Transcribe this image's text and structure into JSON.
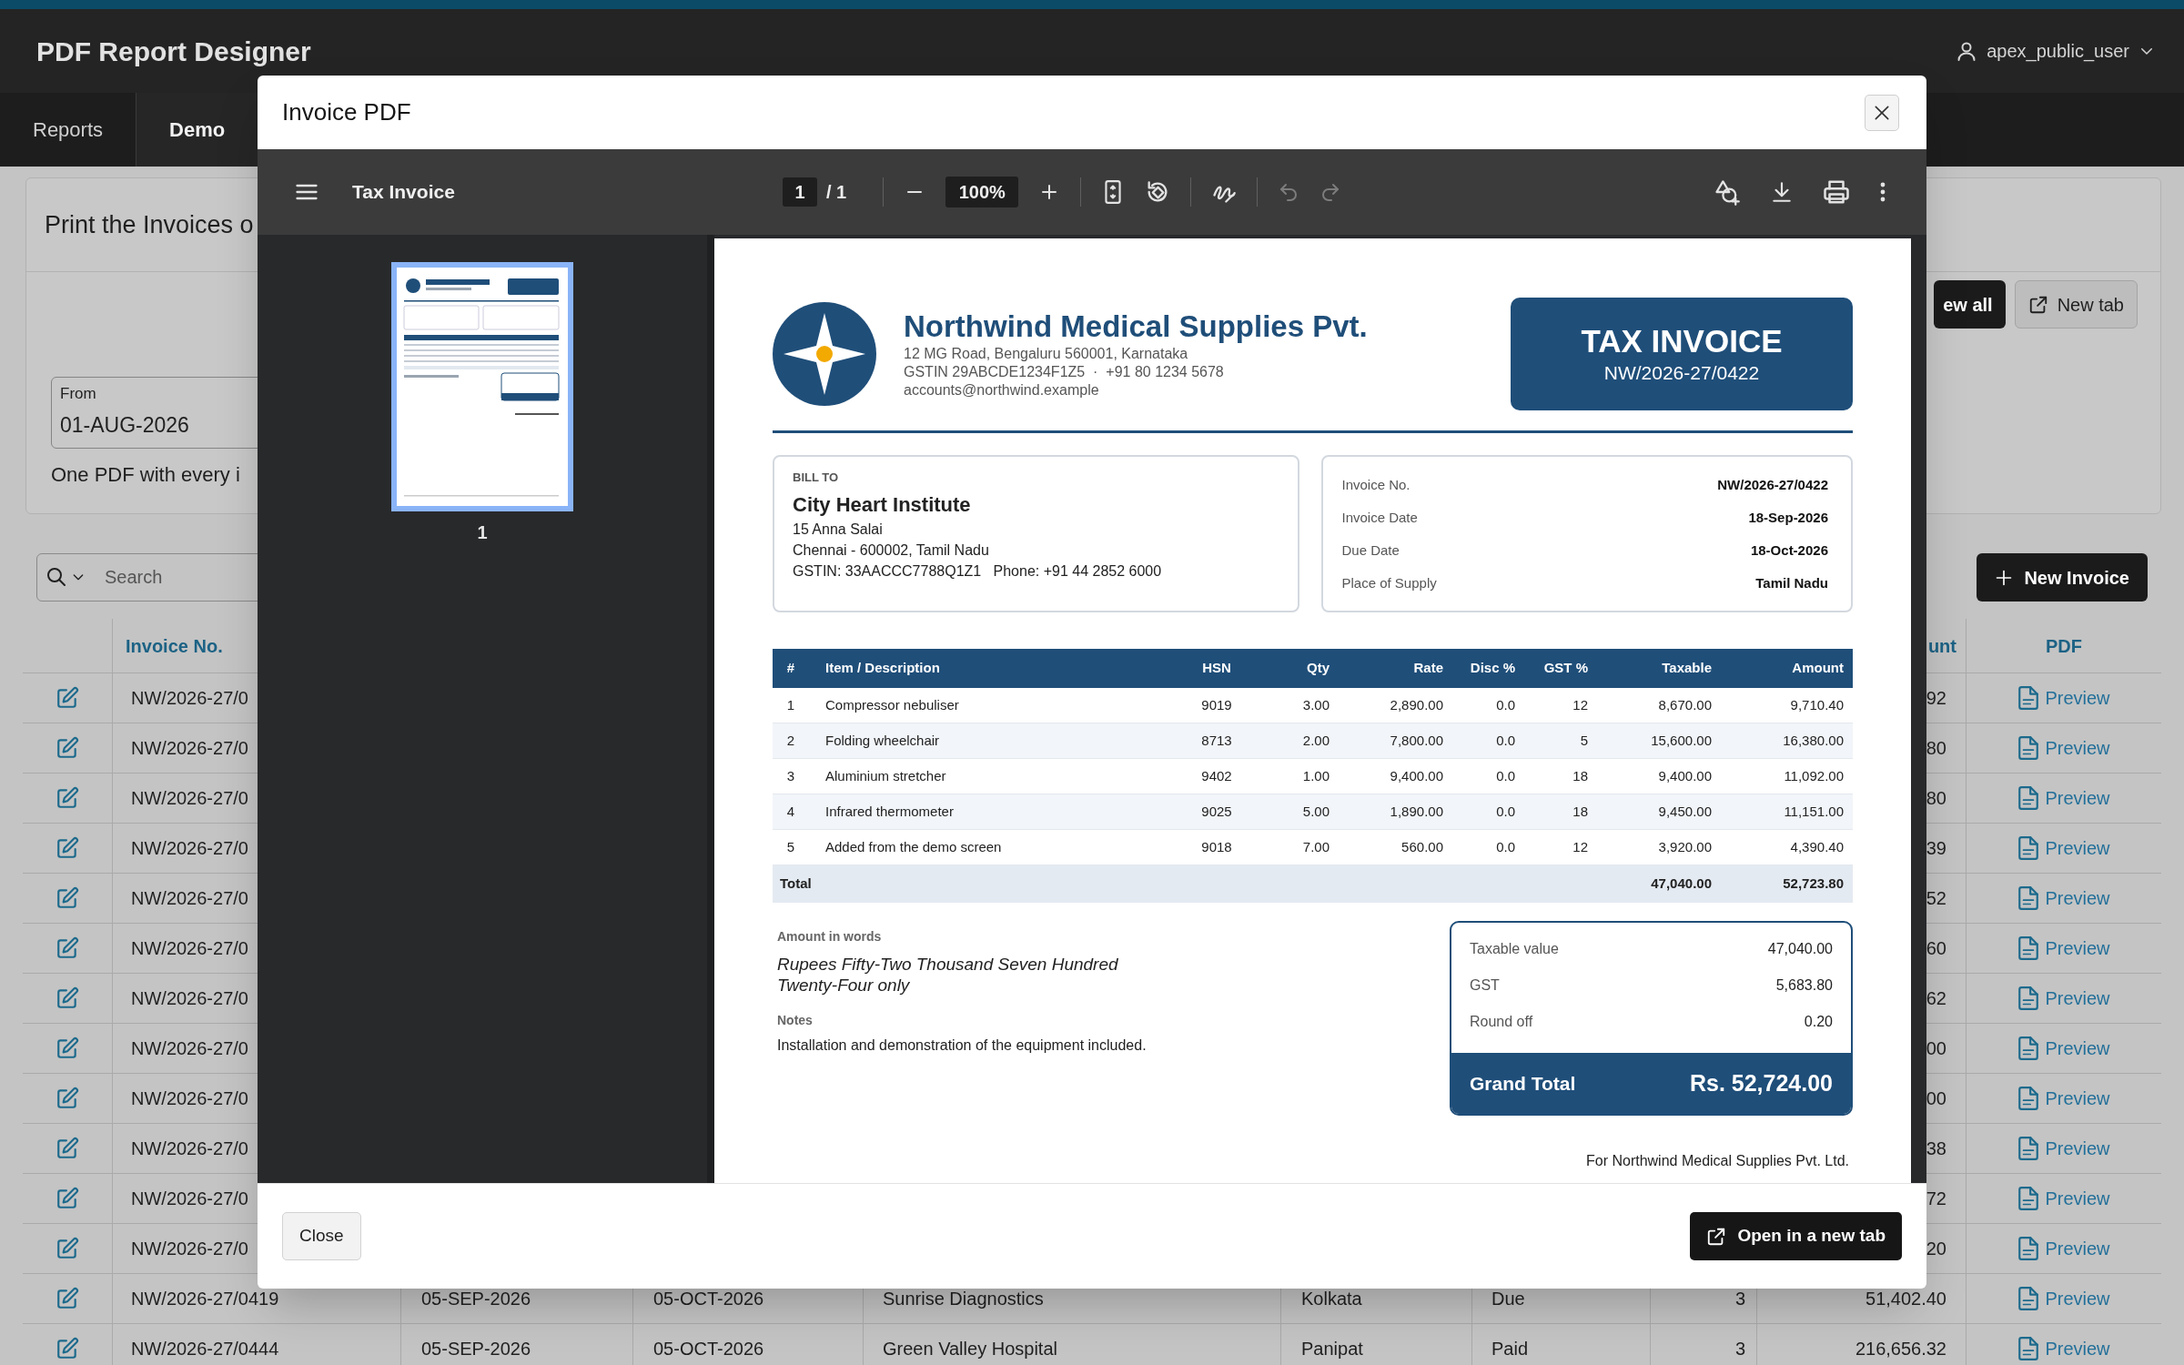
{
  "app": {
    "title": "PDF Report Designer",
    "user": "apex_public_user"
  },
  "nav_tabs": [
    {
      "label": "Reports",
      "selected": false
    },
    {
      "label": "Demo",
      "selected": true
    }
  ],
  "print_card": {
    "title": "Print the Invoices o",
    "from_field": {
      "label": "From",
      "value": "01-AUG-2026"
    },
    "help_text": "One PDF with every i",
    "buttons": [
      {
        "label": "ew all",
        "kind": "primary"
      },
      {
        "label": "New tab",
        "kind": "secondary"
      }
    ]
  },
  "search": {
    "placeholder": "Search"
  },
  "new_button": "New Invoice",
  "table": {
    "columns": {
      "invoice_no": "Invoice No.",
      "amount": "unt",
      "pdf": "PDF"
    },
    "rows": [
      {
        "invoice_no": "NW/2026-27/0",
        "amount": "92",
        "pdf": "Preview"
      },
      {
        "invoice_no": "NW/2026-27/0",
        "amount": "80",
        "pdf": "Preview"
      },
      {
        "invoice_no": "NW/2026-27/0",
        "amount": "80",
        "pdf": "Preview"
      },
      {
        "invoice_no": "NW/2026-27/0",
        "amount": "39",
        "pdf": "Preview"
      },
      {
        "invoice_no": "NW/2026-27/0",
        "amount": "52",
        "pdf": "Preview"
      },
      {
        "invoice_no": "NW/2026-27/0",
        "amount": "60",
        "pdf": "Preview"
      },
      {
        "invoice_no": "NW/2026-27/0",
        "amount": "62",
        "pdf": "Preview"
      },
      {
        "invoice_no": "NW/2026-27/0",
        "amount": "00",
        "pdf": "Preview"
      },
      {
        "invoice_no": "NW/2026-27/0",
        "amount": "00",
        "pdf": "Preview"
      },
      {
        "invoice_no": "NW/2026-27/0",
        "amount": "38",
        "pdf": "Preview"
      },
      {
        "invoice_no": "NW/2026-27/0",
        "amount": "72",
        "pdf": "Preview"
      },
      {
        "invoice_no": "NW/2026-27/0",
        "amount": "20",
        "pdf": "Preview"
      },
      {
        "invoice_no": "NW/2026-27/0419",
        "issue_date": "05-SEP-2026",
        "due_date": "05-OCT-2026",
        "customer": "Sunrise Diagnostics",
        "city": "Kolkata",
        "status": "Due",
        "count": "3",
        "amount": "51,402.40",
        "pdf": "Preview"
      },
      {
        "invoice_no": "NW/2026-27/0444",
        "issue_date": "05-SEP-2026",
        "due_date": "05-OCT-2026",
        "customer": "Green Valley Hospital",
        "city": "Panipat",
        "status": "Paid",
        "count": "3",
        "amount": "216,656.32",
        "pdf": "Preview"
      }
    ]
  },
  "modal": {
    "title": "Invoice PDF",
    "viewer": {
      "document_title": "Tax Invoice",
      "page": "1",
      "page_total": "/ 1",
      "zoom": "100%",
      "undo": {
        "disabled": true
      },
      "redo": {
        "disabled": true
      },
      "thumbnails": [
        {
          "label": "1",
          "selected": true
        }
      ]
    },
    "document": {
      "company": {
        "name": "Northwind Medical Supplies Pvt.",
        "address_lines": [
          "12 MG Road, Bengaluru 560001, Karnataka",
          "GSTIN 29ABCDE1234F1Z5  ·  +91 80 1234 5678",
          "accounts@northwind.example"
        ]
      },
      "title_box": {
        "title": "TAX INVOICE",
        "number": "NW/2026-27/0422"
      },
      "bill_to": {
        "heading": "BILL TO",
        "name": "City Heart Institute",
        "lines": [
          "15 Anna Salai",
          "Chennai - 600002, Tamil Nadu",
          "GSTIN: 33AACCC7788Q1Z1   Phone: +91 44 2852 6000"
        ]
      },
      "details": [
        {
          "label": "Invoice No.",
          "value": "NW/2026-27/0422"
        },
        {
          "label": "Invoice Date",
          "value": "18-Sep-2026"
        },
        {
          "label": "Due Date",
          "value": "18-Oct-2026"
        },
        {
          "label": "Place of Supply",
          "value": "Tamil Nadu"
        }
      ],
      "items": {
        "columns": [
          "#",
          "Item / Description",
          "HSN",
          "Qty",
          "Rate",
          "Disc %",
          "GST %",
          "Taxable",
          "Amount"
        ],
        "rows": [
          [
            "1",
            "Compressor nebuliser",
            "9019",
            "3.00",
            "2,890.00",
            "0.0",
            "12",
            "8,670.00",
            "9,710.40"
          ],
          [
            "2",
            "Folding wheelchair",
            "8713",
            "2.00",
            "7,800.00",
            "0.0",
            "5",
            "15,600.00",
            "16,380.00"
          ],
          [
            "3",
            "Aluminium stretcher",
            "9402",
            "1.00",
            "9,400.00",
            "0.0",
            "18",
            "9,400.00",
            "11,092.00"
          ],
          [
            "4",
            "Infrared thermometer",
            "9025",
            "5.00",
            "1,890.00",
            "0.0",
            "18",
            "9,450.00",
            "11,151.00"
          ],
          [
            "5",
            "Added from the demo screen",
            "9018",
            "7.00",
            "560.00",
            "0.0",
            "12",
            "3,920.00",
            "4,390.40"
          ]
        ],
        "total": {
          "label": "Total",
          "taxable": "47,040.00",
          "amount": "52,723.80"
        }
      },
      "amount_in_words": {
        "heading": "Amount in words",
        "text": "Rupees Fifty-Two Thousand Seven Hundred Twenty-Four only"
      },
      "notes": {
        "heading": "Notes",
        "text": "Installation and demonstration of the equipment included."
      },
      "summary": {
        "rows": [
          {
            "label": "Taxable value",
            "value": "47,040.00"
          },
          {
            "label": "GST",
            "value": "5,683.80"
          },
          {
            "label": "Round off",
            "value": "0.20"
          }
        ],
        "grand_total": {
          "label": "Grand Total",
          "value": "Rs. 52,724.00"
        }
      },
      "signature": "For Northwind Medical Supplies Pvt. Ltd."
    },
    "buttons": {
      "close": "Close",
      "open": "Open in a new tab"
    }
  }
}
